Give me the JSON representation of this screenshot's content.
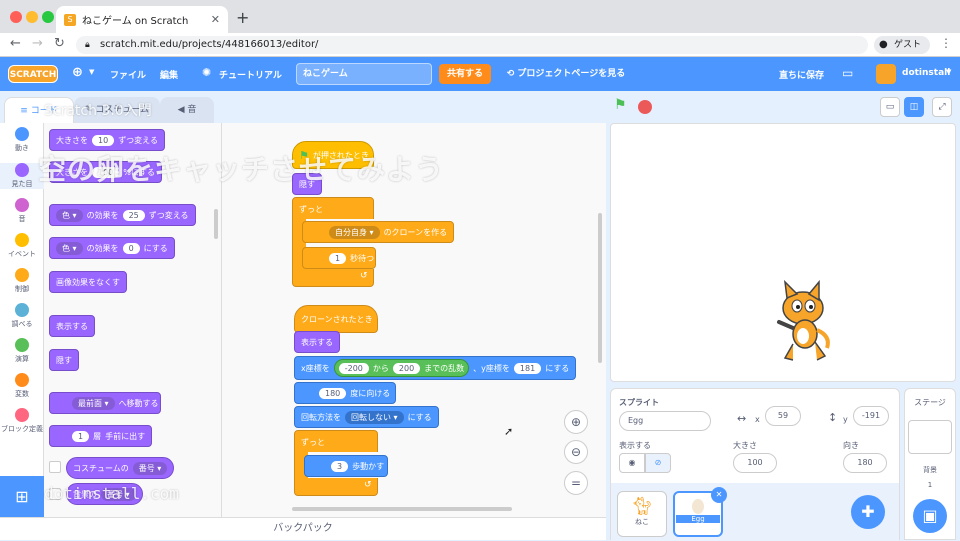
{
  "browser": {
    "tab_title": "ねこゲーム on Scratch",
    "url": "scratch.mit.edu/projects/448166013/editor/",
    "profile": "ゲスト"
  },
  "menu": {
    "logo": "SCRATCH",
    "file": "ファイル",
    "edit": "編集",
    "tutorial": "チュートリアル",
    "project_name": "ねこゲーム",
    "share": "共有する",
    "see_project": "プロジェクトページを見る",
    "save_now": "直ちに保存",
    "username": "dotinstall"
  },
  "editor_tabs": {
    "code": "コード",
    "costume": "コスチューム",
    "sound": "音"
  },
  "categories": [
    {
      "label": "動き",
      "color": "#4c97ff"
    },
    {
      "label": "見た目",
      "color": "#9966ff"
    },
    {
      "label": "音",
      "color": "#cf63cf"
    },
    {
      "label": "イベント",
      "color": "#ffbf00"
    },
    {
      "label": "制御",
      "color": "#ffab19"
    },
    {
      "label": "調べる",
      "color": "#5cb1d6"
    },
    {
      "label": "演算",
      "color": "#59c059"
    },
    {
      "label": "変数",
      "color": "#ff8c1a"
    },
    {
      "label": "ブロック定義",
      "color": "#ff6680"
    }
  ],
  "palette": {
    "size_change_a": "大きさを",
    "size_change_v": "10",
    "size_change_b": "ずつ変える",
    "size_set_a": "大きさを",
    "size_set_v": "100",
    "size_set_b": "%にする",
    "effect_change_a": "色",
    "effect_change_b": "の効果を",
    "effect_change_v": "25",
    "effect_change_c": "ずつ変える",
    "effect_set_a": "色",
    "effect_set_b": "の効果を",
    "effect_set_v": "0",
    "effect_set_c": "にする",
    "clear_effects": "画像効果をなくす",
    "show": "表示する",
    "hide": "隠す",
    "layer_front": "最前面",
    "layer_front_b": "へ移動する",
    "layer_move_v": "1",
    "layer_move_a": "層",
    "layer_move_b": "手前に出す",
    "costume_a": "コスチュームの",
    "costume_b": "番号",
    "backdrop_a": "背景の",
    "backdrop_b": "番号"
  },
  "script1": {
    "hat": "が押されたとき",
    "hide": "隠す",
    "forever": "ずっと",
    "clone_target": "自分自身",
    "clone_label": "のクローンを作る",
    "wait_v": "1",
    "wait_label": "秒待つ"
  },
  "script2": {
    "hat": "クローンされたとき",
    "show": "表示する",
    "x_label": "x座標を",
    "rand_from": "-200",
    "rand_kara": "から",
    "rand_to": "200",
    "rand_label": "までの乱数",
    "y_label": "、y座標を",
    "y_v": "181",
    "set_suffix": "にする",
    "dir_v": "180",
    "dir_label": "度に向ける",
    "rot_label": "回転方法を",
    "rot_v": "回転しない",
    "rot_suffix": "にする",
    "forever": "ずっと",
    "move_v": "3",
    "move_label": "歩動かす"
  },
  "backpack": "バックパック",
  "sprite_info": {
    "sprite_label": "スプライト",
    "name": "Egg",
    "x_label": "x",
    "x": "59",
    "y_label": "y",
    "y": "-191",
    "show_label": "表示する",
    "size_label": "大きさ",
    "size": "100",
    "direction_label": "向き",
    "direction": "180"
  },
  "sprites": [
    {
      "name": "ねこ"
    },
    {
      "name": "Egg"
    }
  ],
  "stage_pane": {
    "title": "ステージ",
    "backdrops_label": "背景",
    "backdrops_count": "1"
  },
  "overlay": {
    "title_top": "Scratch 3.0入門",
    "title_main": "空の卵をキャッチさせてみよう",
    "watermark": "dotinstall.com"
  }
}
